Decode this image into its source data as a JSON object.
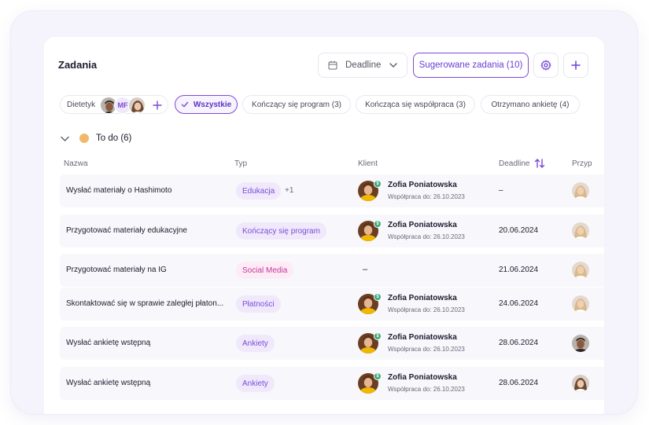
{
  "header": {
    "title": "Zadania",
    "deadline_label": "Deadline",
    "suggested_label": "Sugerowane zadania (10)"
  },
  "filters": {
    "dietetyk_label": "Dietetyk",
    "dietetyk_initials": "MF",
    "all_label": "Wszystkie",
    "chips": [
      "Kończący się program (3)",
      "Kończąca się współpraca (3)",
      "Otrzymano ankietę (4)"
    ]
  },
  "group": {
    "label": "To do (6)",
    "color": "#f2b86a"
  },
  "columns": {
    "name": "Nazwa",
    "type": "Typ",
    "client": "Klient",
    "deadline": "Deadline",
    "assignee": "Przyp"
  },
  "colors": {
    "accent": "#7c4ad9",
    "edu_tag_bg": "#efe9fb",
    "social_tag_text": "#c2379a",
    "row_bg": "#f8f7fb"
  },
  "rows": [
    {
      "name": "Wysłać materiały o Hashimoto",
      "type": "Edukacja",
      "type_extra": "+1",
      "client_name": "Zofia Poniatowska",
      "client_sub": "Współpraca do: 26.10.2023",
      "client_dash": "",
      "deadline": "–",
      "assignee_icon": "female-blonde-avatar"
    },
    {
      "name": "Przygotować materiały edukacyjne",
      "type": "Kończący się program",
      "type_extra": "",
      "client_name": "Zofia Poniatowska",
      "client_sub": "Współpraca do: 26.10.2023",
      "client_dash": "",
      "deadline": "20.06.2024",
      "assignee_icon": "female-blonde-avatar"
    },
    {
      "name": "Przygotować materiały na IG",
      "type": "Social Media",
      "type_extra": "",
      "client_name": "",
      "client_sub": "",
      "client_dash": "–",
      "deadline": "21.06.2024",
      "assignee_icon": "female-blonde-avatar"
    },
    {
      "name": "Skontaktować się w sprawie zaległej płaton...",
      "type": "Płatności",
      "type_extra": "",
      "client_name": "Zofia Poniatowska",
      "client_sub": "Współpraca do: 26.10.2023",
      "client_dash": "",
      "deadline": "24.06.2024",
      "assignee_icon": "female-blonde-avatar"
    },
    {
      "name": "Wysłać ankietę wstępną",
      "type": "Ankiety",
      "type_extra": "",
      "client_name": "Zofia Poniatowska",
      "client_sub": "Współpraca do: 26.10.2023",
      "client_dash": "",
      "deadline": "28.06.2024",
      "assignee_icon": "male-dark-avatar"
    },
    {
      "name": "Wysłać ankietę wstępną",
      "type": "Ankiety",
      "type_extra": "",
      "client_name": "Zofia Poniatowska",
      "client_sub": "Współpraca do: 26.10.2023",
      "client_dash": "",
      "deadline": "28.06.2024",
      "assignee_icon": "female-brunette-avatar"
    }
  ]
}
